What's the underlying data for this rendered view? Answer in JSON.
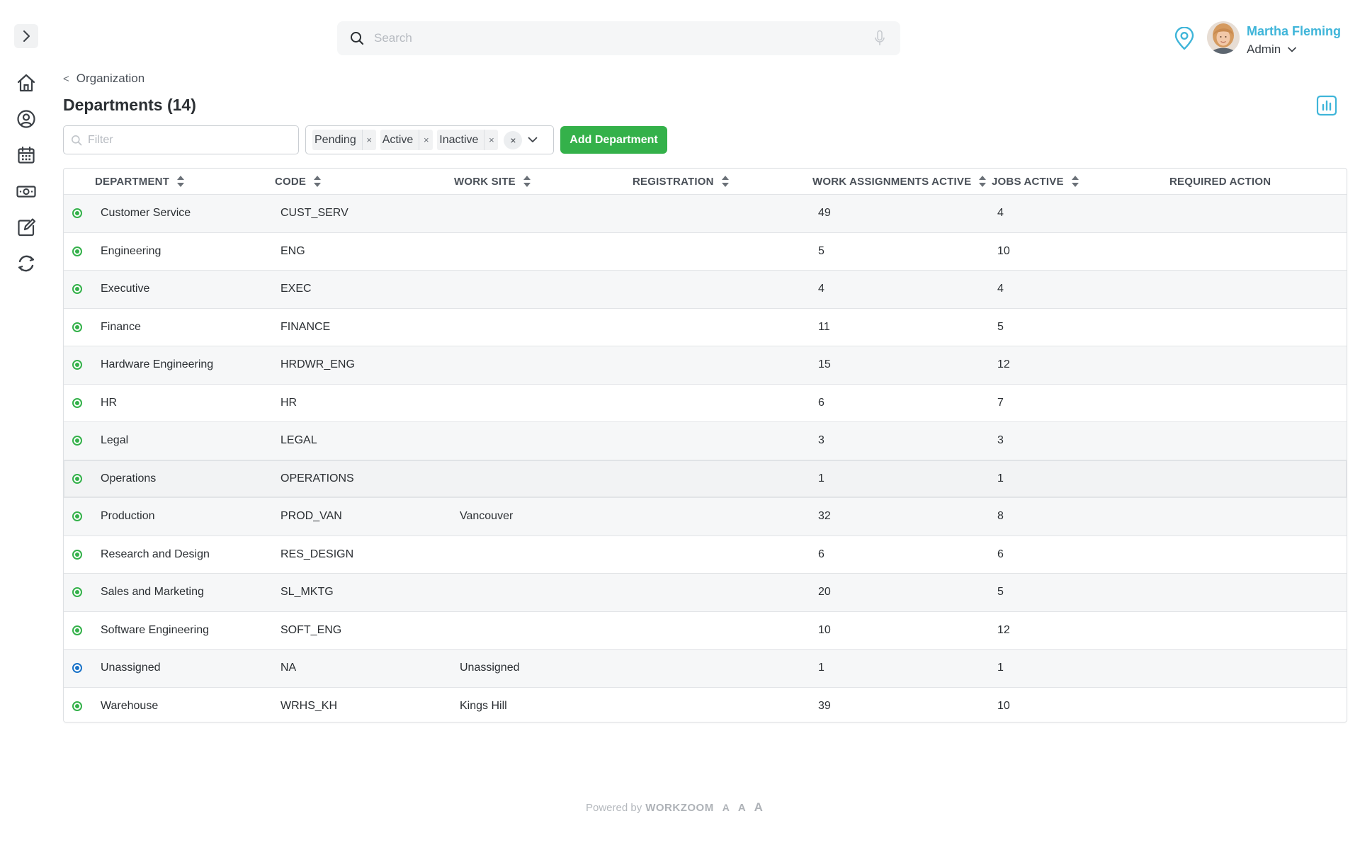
{
  "search": {
    "placeholder": "Search"
  },
  "user": {
    "name": "Martha Fleming",
    "role": "Admin"
  },
  "breadcrumb": {
    "parent": "Organization",
    "chevron": "<"
  },
  "page": {
    "title": "Departments (14)"
  },
  "filter": {
    "placeholder": "Filter"
  },
  "status_filter": {
    "chips": [
      "Pending",
      "Active",
      "Inactive"
    ],
    "remove_glyph": "×",
    "clear_glyph": "×"
  },
  "actions": {
    "add_department": "Add Department"
  },
  "table": {
    "columns": [
      "DEPARTMENT",
      "CODE",
      "WORK SITE",
      "REGISTRATION",
      "WORK ASSIGNMENTS ACTIVE",
      "JOBS ACTIVE",
      "REQUIRED ACTION"
    ],
    "rows": [
      {
        "status": "active",
        "department": "Customer Service",
        "code": "CUST_SERV",
        "work_site": "",
        "registration": "",
        "work_assignments": "49",
        "jobs": "4",
        "required_action": ""
      },
      {
        "status": "active",
        "department": "Engineering",
        "code": "ENG",
        "work_site": "",
        "registration": "",
        "work_assignments": "5",
        "jobs": "10",
        "required_action": ""
      },
      {
        "status": "active",
        "department": "Executive",
        "code": "EXEC",
        "work_site": "",
        "registration": "",
        "work_assignments": "4",
        "jobs": "4",
        "required_action": ""
      },
      {
        "status": "active",
        "department": "Finance",
        "code": "FINANCE",
        "work_site": "",
        "registration": "",
        "work_assignments": "11",
        "jobs": "5",
        "required_action": ""
      },
      {
        "status": "active",
        "department": "Hardware Engineering",
        "code": "HRDWR_ENG",
        "work_site": "",
        "registration": "",
        "work_assignments": "15",
        "jobs": "12",
        "required_action": ""
      },
      {
        "status": "active",
        "department": "HR",
        "code": "HR",
        "work_site": "",
        "registration": "",
        "work_assignments": "6",
        "jobs": "7",
        "required_action": ""
      },
      {
        "status": "active",
        "department": "Legal",
        "code": "LEGAL",
        "work_site": "",
        "registration": "",
        "work_assignments": "3",
        "jobs": "3",
        "required_action": ""
      },
      {
        "status": "active",
        "department": "Operations",
        "code": "OPERATIONS",
        "work_site": "",
        "registration": "",
        "work_assignments": "1",
        "jobs": "1",
        "required_action": ""
      },
      {
        "status": "active",
        "department": "Production",
        "code": "PROD_VAN",
        "work_site": "Vancouver",
        "registration": "",
        "work_assignments": "32",
        "jobs": "8",
        "required_action": ""
      },
      {
        "status": "active",
        "department": "Research and Design",
        "code": "RES_DESIGN",
        "work_site": "",
        "registration": "",
        "work_assignments": "6",
        "jobs": "6",
        "required_action": ""
      },
      {
        "status": "active",
        "department": "Sales and Marketing",
        "code": "SL_MKTG",
        "work_site": "",
        "registration": "",
        "work_assignments": "20",
        "jobs": "5",
        "required_action": ""
      },
      {
        "status": "active",
        "department": "Software Engineering",
        "code": "SOFT_ENG",
        "work_site": "",
        "registration": "",
        "work_assignments": "10",
        "jobs": "12",
        "required_action": ""
      },
      {
        "status": "pending",
        "department": "Unassigned",
        "code": "NA",
        "work_site": "Unassigned",
        "registration": "",
        "work_assignments": "1",
        "jobs": "1",
        "required_action": ""
      },
      {
        "status": "active",
        "department": "Warehouse",
        "code": "WRHS_KH",
        "work_site": "Kings Hill",
        "registration": "",
        "work_assignments": "39",
        "jobs": "10",
        "required_action": ""
      }
    ]
  },
  "footer": {
    "powered_by": "Powered by",
    "brand": "WORKZOOM",
    "font_sizes": [
      "A",
      "A",
      "A"
    ]
  },
  "colors": {
    "accent": "#34b14a",
    "link": "#3fb5d9",
    "status_active": "#34b14a",
    "status_pending": "#1a73c8"
  },
  "icons": {
    "rail": [
      "chevron-right-icon",
      "home-icon",
      "user-circle-icon",
      "calendar-icon",
      "money-icon",
      "edit-icon",
      "refresh-icon"
    ],
    "top": [
      "search-icon",
      "microphone-icon",
      "location-pin-icon",
      "chevron-down-icon"
    ],
    "header": [
      "bar-chart-icon"
    ]
  }
}
